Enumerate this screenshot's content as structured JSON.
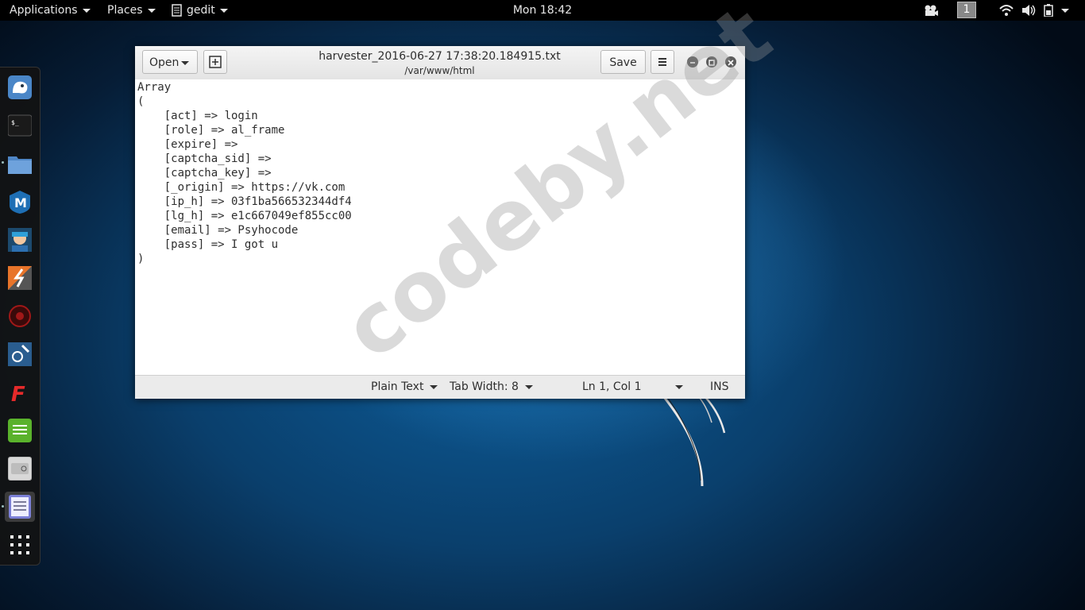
{
  "topbar": {
    "applications_label": "Applications",
    "places_label": "Places",
    "app_name": "gedit",
    "clock": "Mon 18:42",
    "workspace_number": "1",
    "icons": [
      "camera-icon",
      "wifi-icon",
      "volume-icon",
      "battery-icon"
    ]
  },
  "dock": {
    "items": [
      "kali-menu-icon",
      "terminal-icon",
      "files-icon",
      "metasploit-icon",
      "armitage-icon",
      "burpsuite-icon",
      "beef-icon",
      "maltego-icon",
      "faraday-icon",
      "leafpad-icon",
      "cherrytree-icon",
      "gedit-icon",
      "show-apps-icon"
    ]
  },
  "gedit": {
    "open_label": "Open",
    "save_label": "Save",
    "title": "harvester_2016-06-27 17:38:20.184915.txt",
    "subtitle": "/var/www/html",
    "lines": [
      "Array",
      "(",
      "    [act] => login",
      "    [role] => al_frame",
      "    [expire] =>",
      "    [captcha_sid] =>",
      "    [captcha_key] =>",
      "    [_origin] => https://vk.com",
      "    [ip_h] => 03f1ba566532344df4",
      "    [lg_h] => e1c667049ef855cc00",
      "    [email] => Psyhocode",
      "    [pass] => I got u",
      ")"
    ],
    "status": {
      "language": "Plain Text",
      "tab_width": "Tab Width: 8",
      "position": "Ln 1, Col 1",
      "mode": "INS"
    }
  },
  "watermark": "codeby.net",
  "colors": {
    "topbar": "#000000",
    "desktop_blue": "#0d5d9a",
    "window_bg": "#ffffff"
  }
}
